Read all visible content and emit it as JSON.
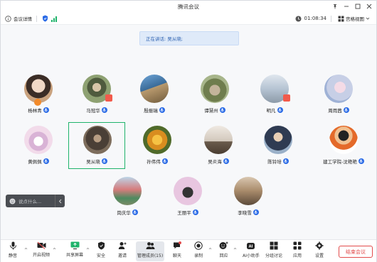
{
  "window": {
    "title": "腾讯会议"
  },
  "infobar": {
    "details_label": "会议详情",
    "timer": "01:08:34",
    "view_label": "宫格视图"
  },
  "speaking": {
    "text": "正在讲话: 吴从晓;"
  },
  "participants": [
    {
      "name": "杨林青",
      "avatar_color": "#c9a27e"
    },
    {
      "name": "马冠华",
      "avatar_color": "#7c8d6b"
    },
    {
      "name": "殷振瑞",
      "avatar_color": "#5a86b3"
    },
    {
      "name": "谭慧州",
      "avatar_color": "#8a9a6a"
    },
    {
      "name": "明凡",
      "avatar_color": "#a9b8c9"
    },
    {
      "name": "周雨茜",
      "avatar_color": "#c7cfe6"
    },
    {
      "name": "黄佩佩",
      "avatar_color": "#e9c8d8"
    },
    {
      "name": "吴从晓",
      "avatar_color": "#6b6155"
    },
    {
      "name": "孙伟伟",
      "avatar_color": "#e0a23a"
    },
    {
      "name": "吴炎海",
      "avatar_color": "#d9d3cb"
    },
    {
      "name": "陈铃培",
      "avatar_color": "#5b6f8c"
    },
    {
      "name": "建工学院-沈艳艳",
      "avatar_color": "#f3f3f3"
    },
    {
      "name": "岗庆华",
      "avatar_color": "#9bb7a8"
    },
    {
      "name": "王丽平",
      "avatar_color": "#e8c6e0"
    },
    {
      "name": "李晓雪",
      "avatar_color": "#b39b84"
    }
  ],
  "chat": {
    "placeholder": "说点什么..."
  },
  "toolbar": {
    "mute": "静音",
    "video": "开启视频",
    "share": "共享屏幕",
    "security": "安全",
    "invite": "邀请",
    "members": "管理成员(15)",
    "chat": "聊天",
    "record": "录制",
    "reactions": "回应",
    "ai": "AI小助手",
    "breakout": "分组讨论",
    "apps": "应用",
    "settings": "设置",
    "end": "结束会议"
  },
  "colors": {
    "accent": "#2b6be6",
    "selected_border": "#1fb36b",
    "danger": "#e24b4b"
  }
}
